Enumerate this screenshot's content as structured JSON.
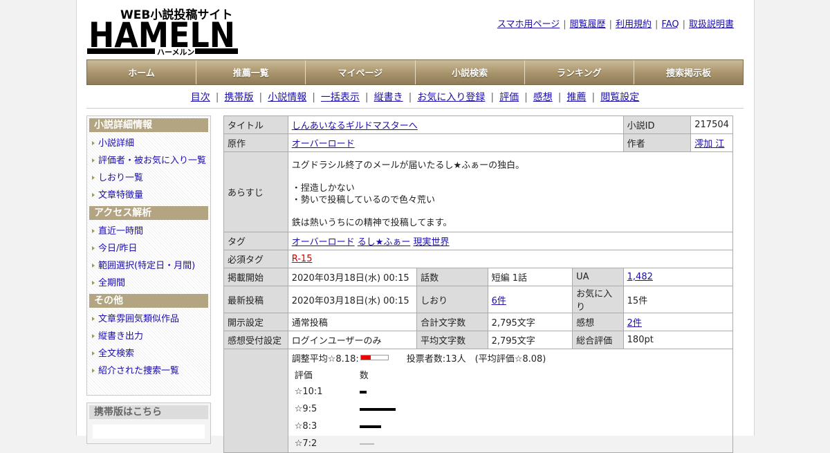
{
  "site": {
    "logo_text": "WEB小説投稿サイト HAMELN ハーメルン",
    "logo_tagline": "WEB小説投稿サイト",
    "logo_main": "HAMELN",
    "logo_kana": "ハーメルン",
    "accent_color": "#a8936b",
    "link_color": "#1a0dab"
  },
  "top_links": [
    "スマホ用ページ",
    "閲覧履歴",
    "利用規約",
    "FAQ",
    "取扱説明書"
  ],
  "main_menu": [
    "ホーム",
    "推薦一覧",
    "マイページ",
    "小説検索",
    "ランキング",
    "捜索掲示板"
  ],
  "sub_menu": [
    "目次",
    "携帯版",
    "小説情報",
    "一括表示",
    "縦書き",
    "お気に入り登録",
    "評価",
    "感想",
    "推薦",
    "閲覧設定"
  ],
  "sidebar": {
    "sections": [
      {
        "title": "小説詳細情報",
        "items": [
          "小説詳細",
          "評価者・被お気に入り一覧",
          "しおり一覧",
          "文章特徴量"
        ]
      },
      {
        "title": "アクセス解析",
        "items": [
          "直近一時間",
          "今日/昨日",
          "範囲選択(特定日・月間)",
          "全期間"
        ]
      },
      {
        "title": "その他",
        "items": [
          "文章雰囲気類似作品",
          "縦書き出力",
          "全文検索",
          "紹介された捜索一覧"
        ]
      }
    ],
    "mobile_box_title": "携帯版はこちら"
  },
  "novel": {
    "title_label": "タイトル",
    "title": "しんあいなるギルドマスターへ",
    "id_label": "小説ID",
    "id": "217504",
    "original_label": "原作",
    "original": "オーバーロード",
    "author_label": "作者",
    "author": "澪加 江",
    "synopsis_label": "あらすじ",
    "synopsis_lines": [
      "ユグドラシル終了のメールが届いたるし★ふぁーの独白。",
      "",
      "・捏造しかない",
      "・勢いで投稿しているので色々荒い",
      "",
      "鉄は熱いうちにの精神で投稿してます。"
    ],
    "tags_label": "タグ",
    "tags": [
      "オーバーロード",
      "るし★ふぁー",
      "現実世界"
    ],
    "required_tag_label": "必須タグ",
    "required_tag": "R-15",
    "published_label": "掲載開始",
    "published": "2020年03月18日(水) 00:15",
    "episodes_label": "話数",
    "episodes": "短編 1話",
    "ua_label": "UA",
    "ua": "1,482",
    "latest_label": "最新投稿",
    "latest": "2020年03月18日(水) 00:15",
    "bookmarks_label": "しおり",
    "bookmarks": "6件",
    "favorites_label": "お気に入り",
    "favorites": "15件",
    "visibility_label": "開示設定",
    "visibility": "通常投稿",
    "total_chars_label": "合計文字数",
    "total_chars": "2,795文字",
    "reviews_label": "感想",
    "reviews": "2件",
    "review_accept_label": "感想受付設定",
    "review_accept": "ログインユーザーのみ",
    "avg_chars_label": "平均文字数",
    "avg_chars": "2,795文字",
    "total_eval_label": "総合評価",
    "total_eval": "180pt"
  },
  "rating": {
    "adjusted_avg_text": "調整平均☆8.18:",
    "adjusted_avg_value": 8.18,
    "vote_info_text": "投票者数:13人　(平均評価☆8.08)",
    "col_rating": "評価",
    "col_count": "数",
    "rows": [
      {
        "label": "☆10:1",
        "count": 1
      },
      {
        "label": "☆9:5",
        "count": 5
      },
      {
        "label": "☆8:3",
        "count": 3
      },
      {
        "label": "☆7:2",
        "count": 2
      }
    ]
  }
}
